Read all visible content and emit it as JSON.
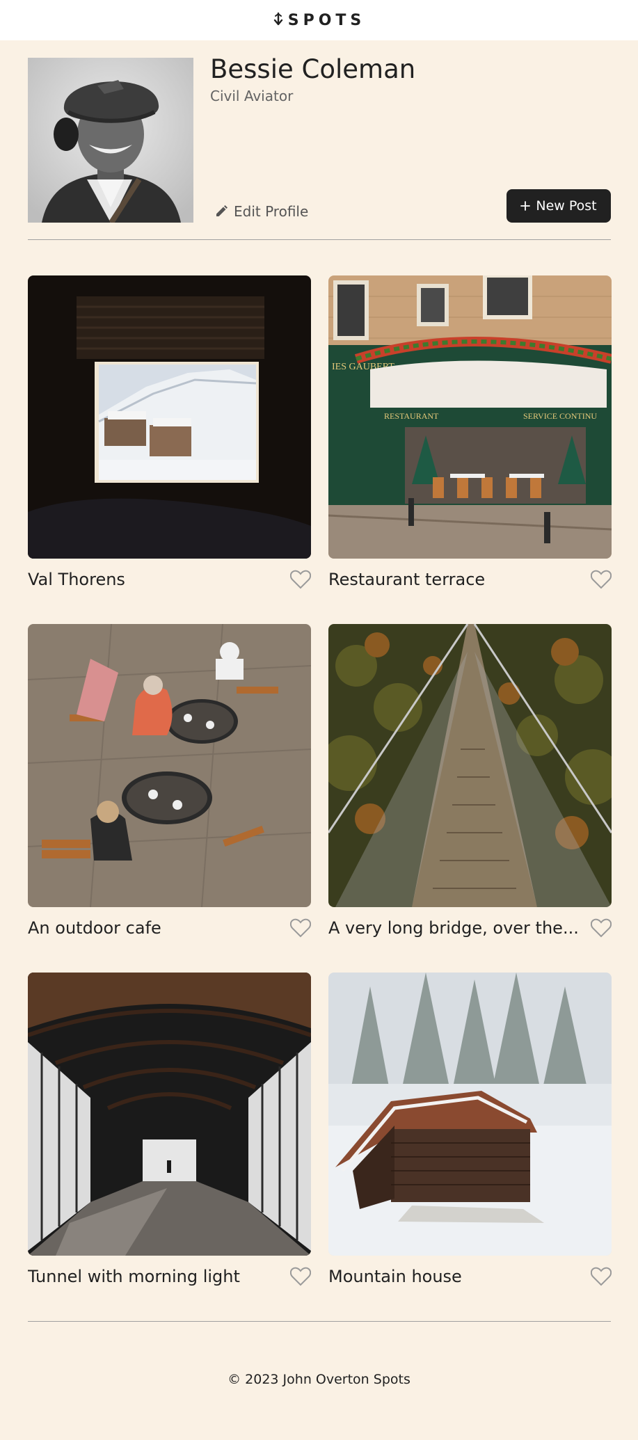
{
  "header": {
    "logo_text": "SPOTS"
  },
  "profile": {
    "name": "Bessie Coleman",
    "role": "Civil Aviator",
    "edit_label": "Edit Profile",
    "new_post_label": "New Post"
  },
  "cards": [
    {
      "title": "Val Thorens",
      "image": "window-view-snowy-resort"
    },
    {
      "title": "Restaurant terrace",
      "image": "paris-restaurant-facade"
    },
    {
      "title": "An outdoor cafe",
      "image": "overhead-cafe-tables"
    },
    {
      "title": "A very long bridge, over the...",
      "image": "suspension-bridge-forest"
    },
    {
      "title": "Tunnel with morning light",
      "image": "glass-arched-tunnel"
    },
    {
      "title": "Mountain house",
      "image": "wooden-cabin-snow"
    }
  ],
  "footer": {
    "copyright": "© 2023 John Overton Spots"
  },
  "colors": {
    "background": "#FAF1E4",
    "header": "#FFFFFF",
    "text": "#212121",
    "button": "#212121",
    "divider": "#A0A0A0"
  },
  "icons": {
    "logo": "down-arrow-logo-icon",
    "edit": "pencil-icon",
    "new_post": "plus-icon",
    "like": "heart-outline-icon"
  }
}
